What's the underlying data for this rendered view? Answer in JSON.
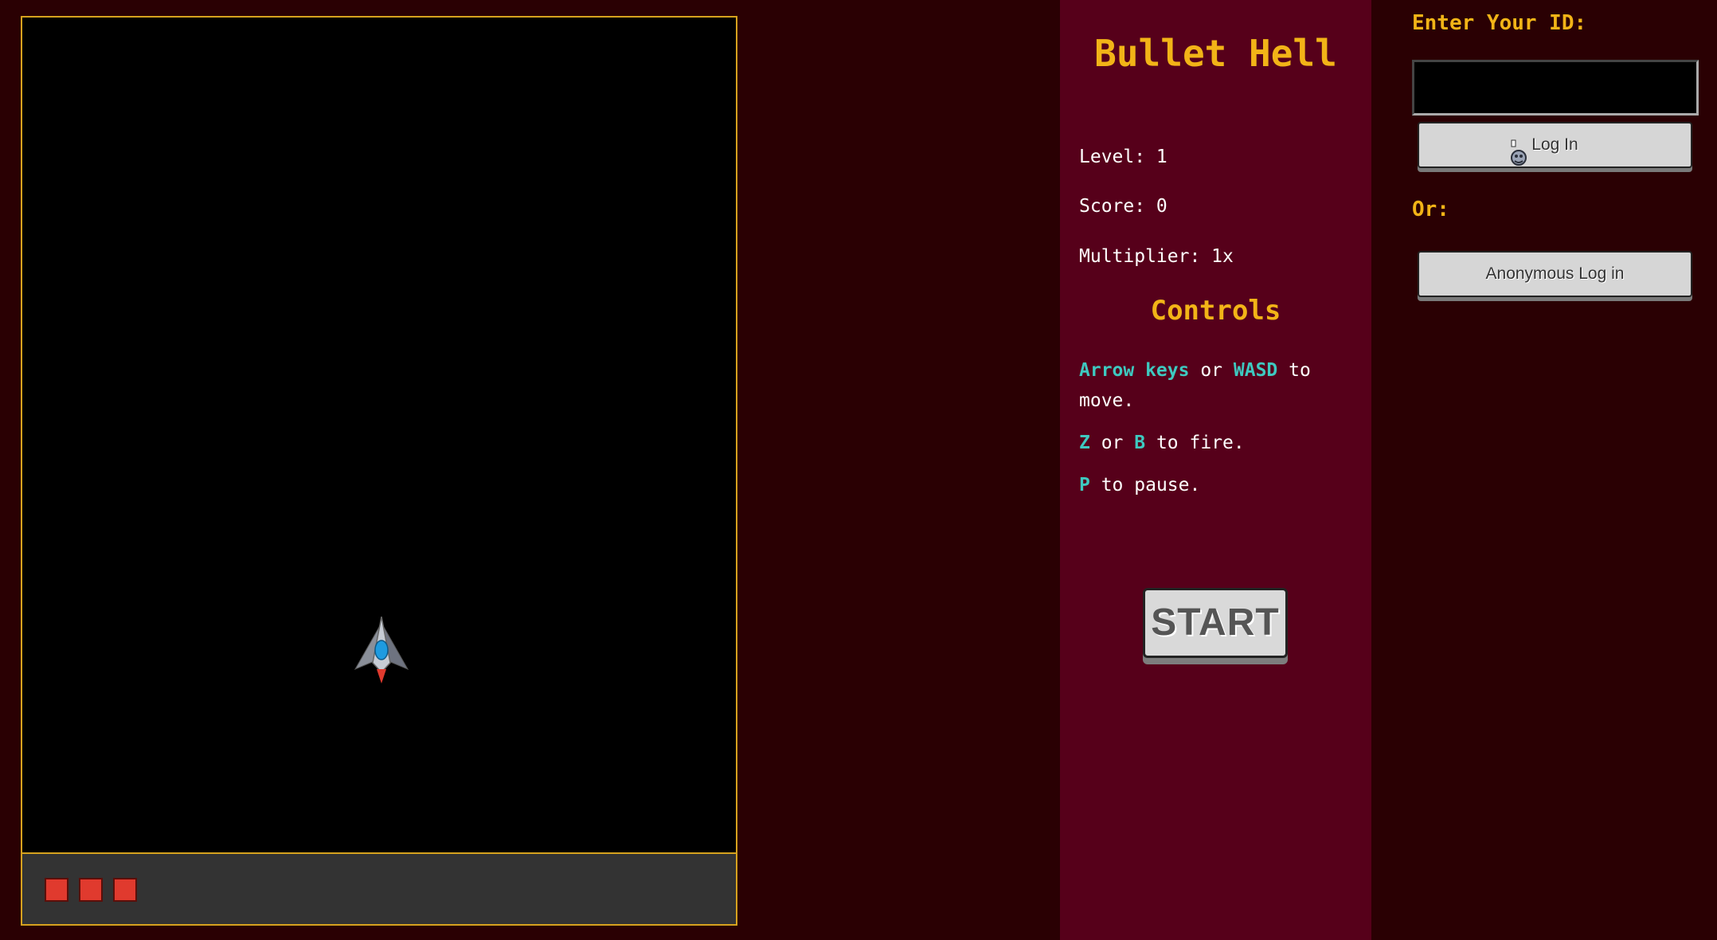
{
  "info": {
    "title": "Bullet Hell",
    "level_text": "Level: 1",
    "score_text": "Score: 0",
    "multiplier_text": "Multiplier: 1x",
    "controls_heading": "Controls",
    "controls": {
      "move_key1": "Arrow keys",
      "move_or": " or ",
      "move_key2": "WASD",
      "move_rest": " to move.",
      "fire_key1": "Z",
      "fire_or": " or ",
      "fire_key2": "B",
      "fire_rest": " to fire.",
      "pause_key": "P",
      "pause_rest": " to pause."
    },
    "start_label": "START"
  },
  "login": {
    "id_label": "Enter Your ID:",
    "id_value": "",
    "login_label": "Log In",
    "or_label": "Or:",
    "anonymous_label": "Anonymous Log in"
  },
  "game": {
    "lives": 3,
    "player_icon": "spaceship-icon"
  },
  "colors": {
    "background": "#2a0003",
    "panel": "#56001a",
    "accent_gold": "#f2b417",
    "key_cyan": "#3ec9c0",
    "life_red": "#e03a2e",
    "border_gold": "#d6a21e"
  }
}
